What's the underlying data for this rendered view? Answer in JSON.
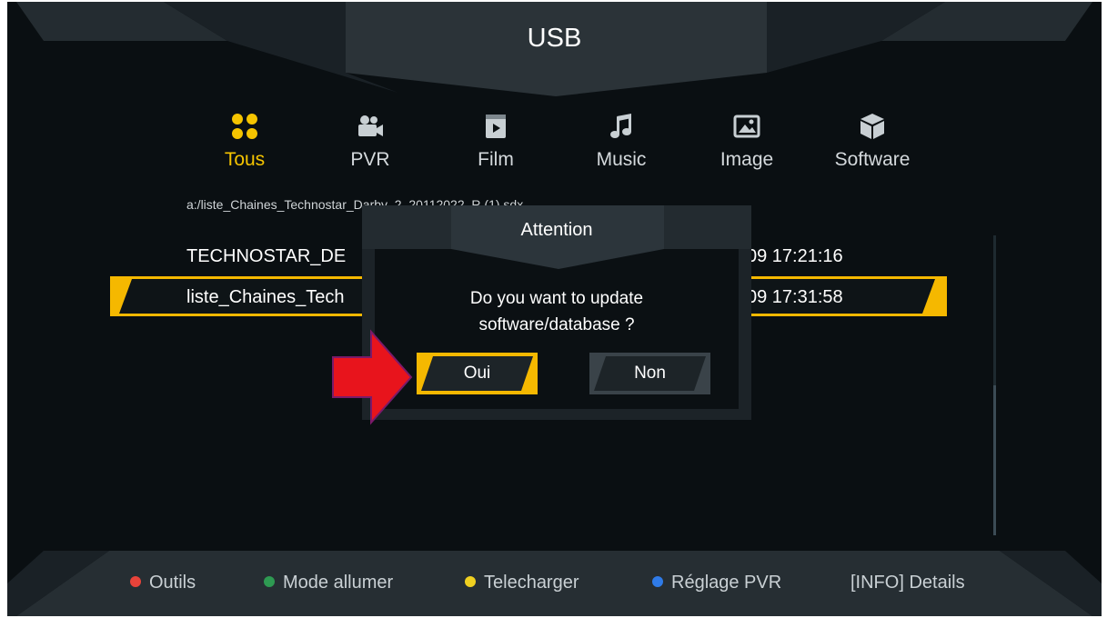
{
  "header": {
    "title": "USB"
  },
  "categories": [
    {
      "label": "Tous",
      "icon": "grid-icon",
      "active": true
    },
    {
      "label": "PVR",
      "icon": "video-camera-icon",
      "active": false
    },
    {
      "label": "Film",
      "icon": "film-icon",
      "active": false
    },
    {
      "label": "Music",
      "icon": "music-note-icon",
      "active": false
    },
    {
      "label": "Image",
      "icon": "image-icon",
      "active": false
    },
    {
      "label": "Software",
      "icon": "box-icon",
      "active": false
    }
  ],
  "file_browser": {
    "path": "a:/liste_Chaines_Technostar_Darby_2_20112022_R (1).sdx",
    "rows": [
      {
        "name": "TECHNOSTAR_DE",
        "date": "09 17:21:16",
        "selected": false
      },
      {
        "name": "liste_Chaines_Tech",
        "date": "09 17:31:58",
        "selected": true
      }
    ]
  },
  "dialog": {
    "title": "Attention",
    "message_line1": "Do you want to update",
    "message_line2": "software/database ?",
    "confirm_label": "Oui",
    "cancel_label": "Non",
    "focused": "confirm"
  },
  "footer": {
    "items": [
      {
        "label": "Outils",
        "dot_color": "#e8433a"
      },
      {
        "label": "Mode allumer",
        "dot_color": "#2e9a52"
      },
      {
        "label": "Telecharger",
        "dot_color": "#f0d020"
      },
      {
        "label": "Réglage PVR",
        "dot_color": "#2f7be8"
      }
    ],
    "info_label": "[INFO] Details"
  },
  "colors": {
    "accent": "#f5b800",
    "background": "#0a0f12",
    "panel": "#1c2328",
    "arrow": "#e8141c"
  }
}
